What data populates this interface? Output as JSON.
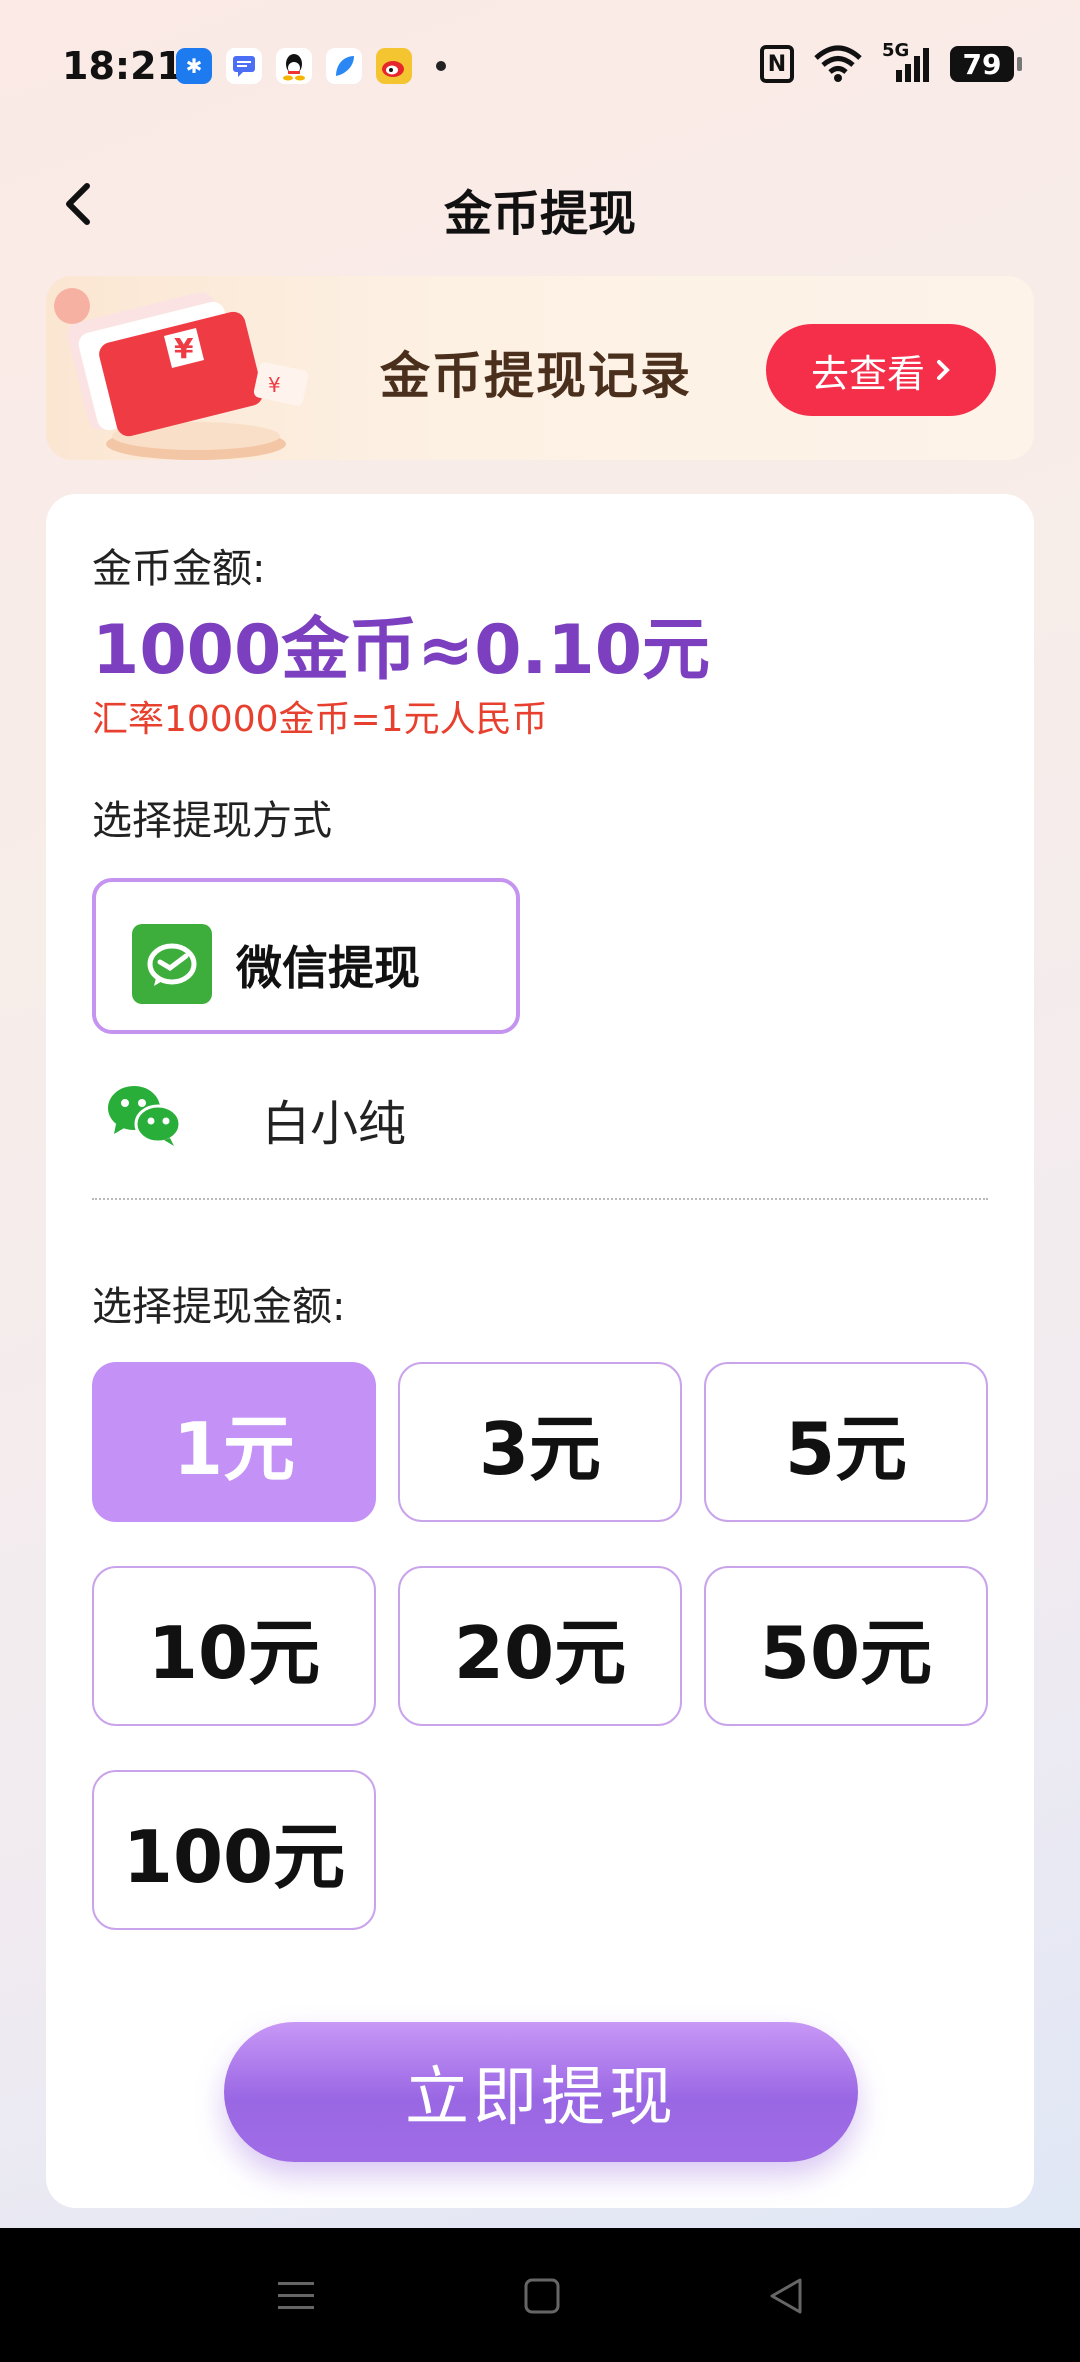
{
  "status_bar": {
    "time": "18:21",
    "battery": "79",
    "nfc_label": "N",
    "signal_label": "5G",
    "icons": [
      "pinwheel-app-icon",
      "message-app-icon",
      "qq-icon",
      "feather-app-icon",
      "weibo-icon",
      "more-dot-icon",
      "nfc-icon",
      "wifi-icon",
      "signal-icon",
      "battery-icon"
    ]
  },
  "header": {
    "title": "金币提现"
  },
  "banner": {
    "title": "金币提现记录",
    "button_label": "去查看",
    "button_color": "#f52e4a"
  },
  "card": {
    "amount_label": "金币金额:",
    "amount_value": "1000金币≈0.10元",
    "rate_text": "汇率10000金币=1元人民币",
    "method_label": "选择提现方式",
    "method_option": "微信提现",
    "account_name": "白小纯",
    "amount_select_label": "选择提现金额:",
    "amounts": [
      "1元",
      "3元",
      "5元",
      "10元",
      "20元",
      "50元",
      "100元"
    ],
    "selected_amount": "1元",
    "withdraw_button": "立即提现",
    "accent_color": "#7b3fbf",
    "selected_color": "#c492f7"
  },
  "nav_bar": {
    "icons": [
      "menu-icon",
      "home-square-icon",
      "back-triangle-icon"
    ]
  }
}
